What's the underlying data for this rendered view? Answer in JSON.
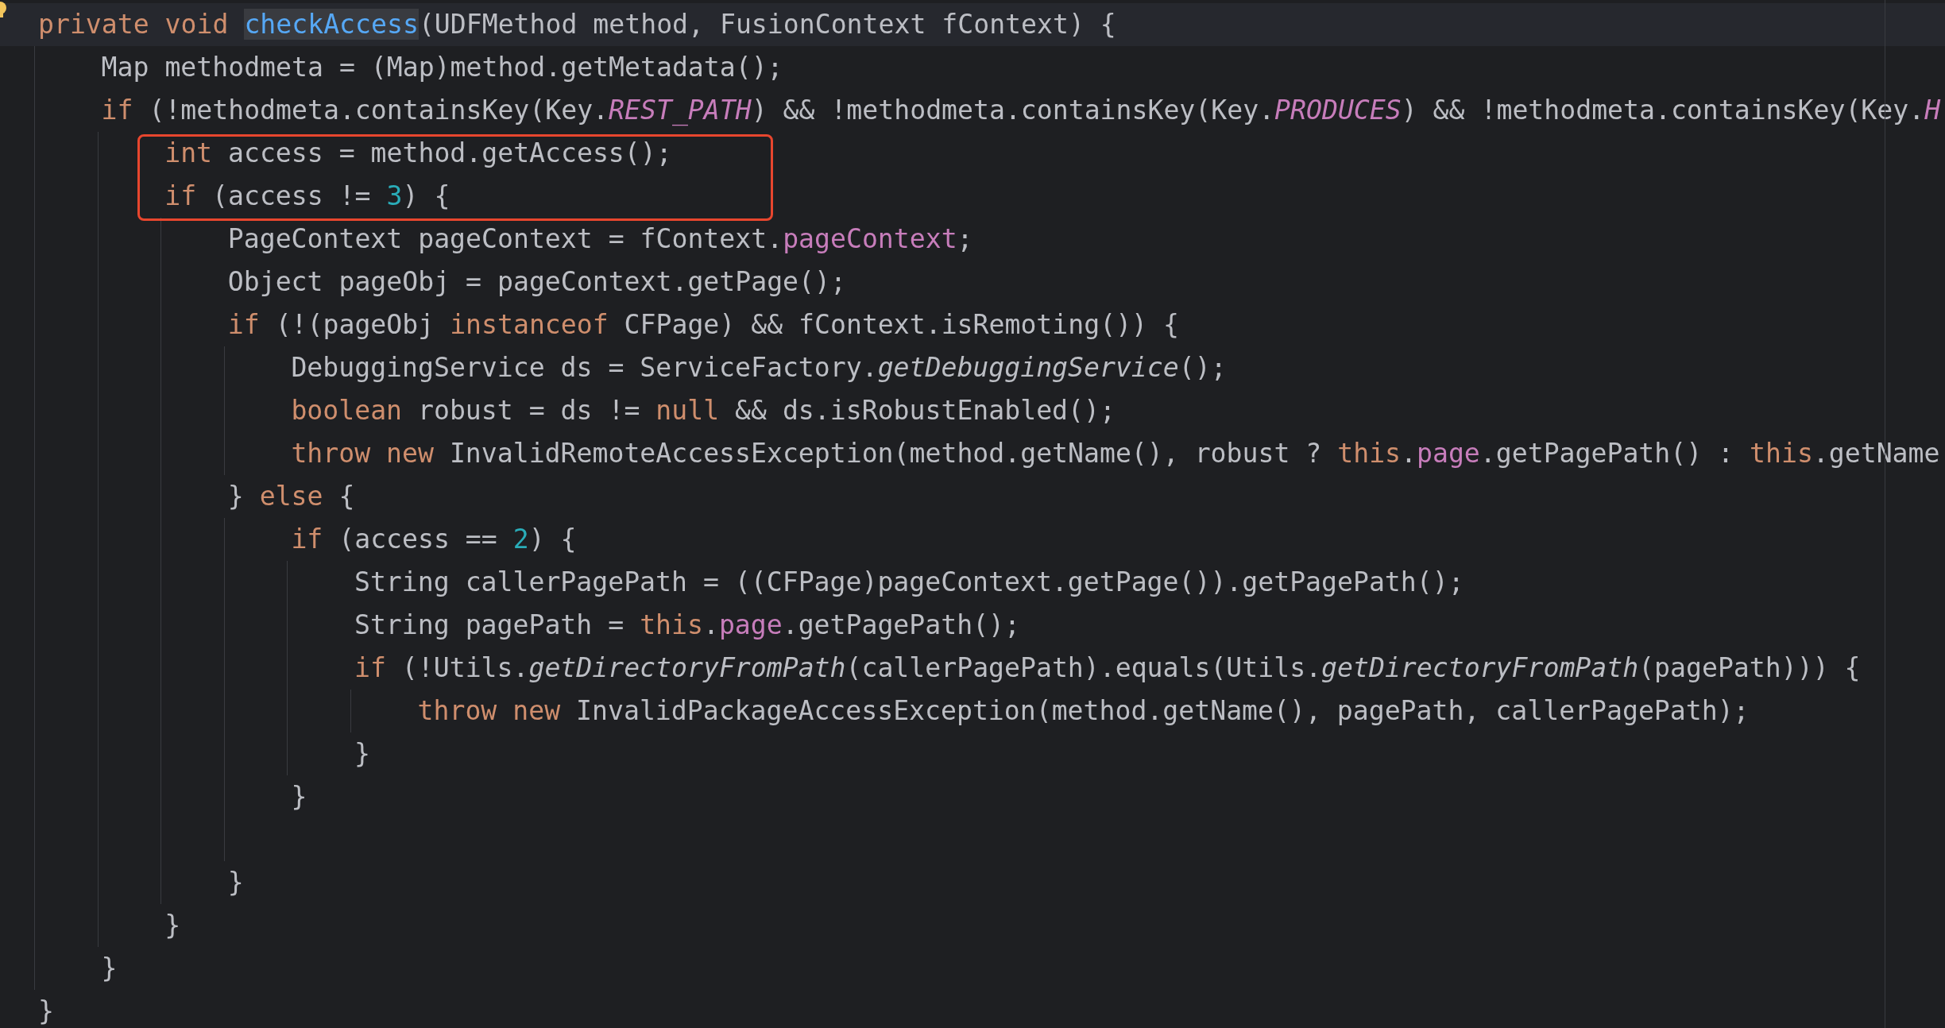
{
  "editor": {
    "lines": [
      {
        "kind": "code",
        "current": true,
        "boxed": false,
        "tokens": [
          {
            "kind": "keyword",
            "text": "private void "
          },
          {
            "kind": "declaration",
            "text": "checkAccess",
            "highlighted": true
          },
          {
            "kind": "plain",
            "text": "(UDFMethod method, FusionContext fContext) {"
          }
        ],
        "children": [
          {
            "kind": "code",
            "current": false,
            "boxed": false,
            "tokens": [
              {
                "kind": "plain",
                "text": "Map methodmeta = (Map)method.getMetadata();"
              }
            ]
          },
          {
            "kind": "code",
            "current": false,
            "boxed": false,
            "tokens": [
              {
                "kind": "keyword",
                "text": "if"
              },
              {
                "kind": "plain",
                "text": " (!methodmeta.containsKey(Key."
              },
              {
                "kind": "constant",
                "text": "REST_PATH"
              },
              {
                "kind": "plain",
                "text": ") && !methodmeta.containsKey(Key."
              },
              {
                "kind": "constant",
                "text": "PRODUCES"
              },
              {
                "kind": "plain",
                "text": ") && !methodmeta.containsKey(Key."
              },
              {
                "kind": "constant",
                "text": "H"
              }
            ],
            "children": [
              {
                "kind": "code",
                "current": false,
                "boxed": true,
                "tokens": [
                  {
                    "kind": "keyword",
                    "text": "int"
                  },
                  {
                    "kind": "plain",
                    "text": " access = method.getAccess();"
                  }
                ]
              },
              {
                "kind": "code",
                "current": false,
                "boxed": true,
                "tokens": [
                  {
                    "kind": "keyword",
                    "text": "if"
                  },
                  {
                    "kind": "plain",
                    "text": " (access != "
                  },
                  {
                    "kind": "number",
                    "text": "3"
                  },
                  {
                    "kind": "plain",
                    "text": ") {"
                  }
                ],
                "children": [
                  {
                    "kind": "code",
                    "current": false,
                    "boxed": false,
                    "tokens": [
                      {
                        "kind": "plain",
                        "text": "PageContext pageContext = fContext."
                      },
                      {
                        "kind": "field",
                        "text": "pageContext"
                      },
                      {
                        "kind": "plain",
                        "text": ";"
                      }
                    ]
                  },
                  {
                    "kind": "code",
                    "current": false,
                    "boxed": false,
                    "tokens": [
                      {
                        "kind": "plain",
                        "text": "Object pageObj = pageContext.getPage();"
                      }
                    ]
                  },
                  {
                    "kind": "code",
                    "current": false,
                    "boxed": false,
                    "tokens": [
                      {
                        "kind": "keyword",
                        "text": "if"
                      },
                      {
                        "kind": "plain",
                        "text": " (!(pageObj "
                      },
                      {
                        "kind": "keyword",
                        "text": "instanceof"
                      },
                      {
                        "kind": "plain",
                        "text": " CFPage) && fContext.isRemoting()) {"
                      }
                    ],
                    "children": [
                      {
                        "kind": "code",
                        "current": false,
                        "boxed": false,
                        "tokens": [
                          {
                            "kind": "plain",
                            "text": "DebuggingService ds = ServiceFactory."
                          },
                          {
                            "kind": "static_call",
                            "text": "getDebuggingService"
                          },
                          {
                            "kind": "plain",
                            "text": "();"
                          }
                        ]
                      },
                      {
                        "kind": "code",
                        "current": false,
                        "boxed": false,
                        "tokens": [
                          {
                            "kind": "keyword",
                            "text": "boolean"
                          },
                          {
                            "kind": "plain",
                            "text": " robust = ds != "
                          },
                          {
                            "kind": "keyword",
                            "text": "null"
                          },
                          {
                            "kind": "plain",
                            "text": " && ds.isRobustEnabled();"
                          }
                        ]
                      },
                      {
                        "kind": "code",
                        "current": false,
                        "boxed": false,
                        "tokens": [
                          {
                            "kind": "keyword",
                            "text": "throw new"
                          },
                          {
                            "kind": "plain",
                            "text": " InvalidRemoteAccessException(method.getName(), robust ? "
                          },
                          {
                            "kind": "keyword",
                            "text": "this"
                          },
                          {
                            "kind": "plain",
                            "text": "."
                          },
                          {
                            "kind": "field",
                            "text": "page"
                          },
                          {
                            "kind": "plain",
                            "text": ".getPagePath() : "
                          },
                          {
                            "kind": "keyword",
                            "text": "this"
                          },
                          {
                            "kind": "plain",
                            "text": ".getName"
                          }
                        ]
                      }
                    ]
                  },
                  {
                    "kind": "code",
                    "current": false,
                    "boxed": false,
                    "tokens": [
                      {
                        "kind": "plain",
                        "text": "} "
                      },
                      {
                        "kind": "keyword",
                        "text": "else"
                      },
                      {
                        "kind": "plain",
                        "text": " {"
                      }
                    ],
                    "children": [
                      {
                        "kind": "code",
                        "current": false,
                        "boxed": false,
                        "tokens": [
                          {
                            "kind": "keyword",
                            "text": "if"
                          },
                          {
                            "kind": "plain",
                            "text": " (access == "
                          },
                          {
                            "kind": "number",
                            "text": "2"
                          },
                          {
                            "kind": "plain",
                            "text": ") {"
                          }
                        ],
                        "children": [
                          {
                            "kind": "code",
                            "current": false,
                            "boxed": false,
                            "tokens": [
                              {
                                "kind": "plain",
                                "text": "String callerPagePath = ((CFPage)pageContext.getPage()).getPagePath();"
                              }
                            ]
                          },
                          {
                            "kind": "code",
                            "current": false,
                            "boxed": false,
                            "tokens": [
                              {
                                "kind": "plain",
                                "text": "String pagePath = "
                              },
                              {
                                "kind": "keyword",
                                "text": "this"
                              },
                              {
                                "kind": "plain",
                                "text": "."
                              },
                              {
                                "kind": "field",
                                "text": "page"
                              },
                              {
                                "kind": "plain",
                                "text": ".getPagePath();"
                              }
                            ]
                          },
                          {
                            "kind": "code",
                            "current": false,
                            "boxed": false,
                            "tokens": [
                              {
                                "kind": "keyword",
                                "text": "if"
                              },
                              {
                                "kind": "plain",
                                "text": " (!Utils."
                              },
                              {
                                "kind": "static_call",
                                "text": "getDirectoryFromPath"
                              },
                              {
                                "kind": "plain",
                                "text": "(callerPagePath).equals(Utils."
                              },
                              {
                                "kind": "static_call",
                                "text": "getDirectoryFromPath"
                              },
                              {
                                "kind": "plain",
                                "text": "(pagePath))) {"
                              }
                            ],
                            "children": [
                              {
                                "kind": "code",
                                "current": false,
                                "boxed": false,
                                "tokens": [
                                  {
                                    "kind": "keyword",
                                    "text": "throw new"
                                  },
                                  {
                                    "kind": "plain",
                                    "text": " InvalidPackageAccessException(method.getName(), pagePath, callerPagePath);"
                                  }
                                ]
                              }
                            ]
                          },
                          {
                            "kind": "code",
                            "current": false,
                            "boxed": false,
                            "tokens": [
                              {
                                "kind": "plain",
                                "text": "}"
                              }
                            ]
                          }
                        ]
                      },
                      {
                        "kind": "code",
                        "current": false,
                        "boxed": false,
                        "tokens": [
                          {
                            "kind": "plain",
                            "text": "}"
                          }
                        ]
                      },
                      {
                        "kind": "blank"
                      }
                    ]
                  },
                  {
                    "kind": "code",
                    "current": false,
                    "boxed": false,
                    "tokens": [
                      {
                        "kind": "plain",
                        "text": "}"
                      }
                    ]
                  }
                ]
              },
              {
                "kind": "code",
                "current": false,
                "boxed": false,
                "tokens": [
                  {
                    "kind": "plain",
                    "text": "}"
                  }
                ]
              }
            ]
          },
          {
            "kind": "code",
            "current": false,
            "boxed": false,
            "tokens": [
              {
                "kind": "plain",
                "text": "}"
              }
            ]
          }
        ]
      },
      {
        "kind": "code",
        "current": false,
        "boxed": false,
        "tokens": [
          {
            "kind": "plain",
            "text": "}"
          }
        ]
      }
    ]
  }
}
